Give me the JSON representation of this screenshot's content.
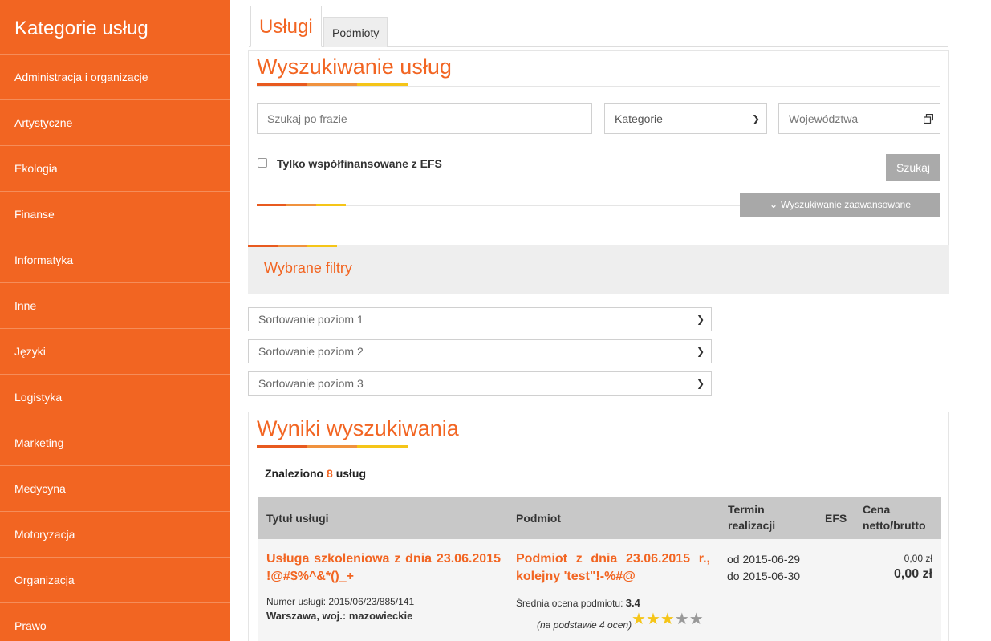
{
  "sidebar": {
    "title": "Kategorie usług",
    "items": [
      "Administracja i organizacje",
      "Artystyczne",
      "Ekologia",
      "Finanse",
      "Informatyka",
      "Inne",
      "Języki",
      "Logistyka",
      "Marketing",
      "Medycyna",
      "Motoryzacja",
      "Organizacja",
      "Prawo"
    ]
  },
  "tabs": {
    "active": "Usługi",
    "other": "Podmioty"
  },
  "search": {
    "title": "Wyszukiwanie usług",
    "phrase_placeholder": "Szukaj po frazie",
    "category_value": "Kategorie",
    "voivodeship_placeholder": "Województwa",
    "efs_label": "Tylko współfinansowane z EFS",
    "search_button": "Szukaj",
    "advanced_button": "Wyszukiwanie zaawansowane"
  },
  "filters": {
    "title": "Wybrane filtry"
  },
  "sorting": [
    "Sortowanie poziom 1",
    "Sortowanie poziom 2",
    "Sortowanie poziom 3"
  ],
  "results": {
    "title": "Wyniki wyszukiwania",
    "found_prefix": "Znaleziono",
    "found_count": "8",
    "found_suffix": "usług",
    "columns": {
      "title": "Tytuł usługi",
      "entity": "Podmiot",
      "term_1": "Termin",
      "term_2": "realizacji",
      "efs": "EFS",
      "price_1": "Cena",
      "price_2": "netto/brutto"
    },
    "rows": [
      {
        "title": "Usługa szkoleniowa z dnia 23.06.2015 !@#$%^&*()_+",
        "number_label": "Numer usługi:",
        "number": "2015/06/23/885/141",
        "location": "Warszawa, woj.: mazowieckie",
        "entity": "Podmiot z dnia 23.06.2015 r., kolejny 'test\"!-%#@",
        "rating_label": "Średnia ocena podmiotu:",
        "rating": "3.4",
        "rating_basis": "(na podstawie 4 ocen)",
        "stars_filled": 3,
        "stars_total": 5,
        "date_from": "od 2015-06-29",
        "date_to": "do 2015-06-30",
        "price_net": "0,00 zł",
        "price_gross": "0,00 zł"
      }
    ]
  }
}
